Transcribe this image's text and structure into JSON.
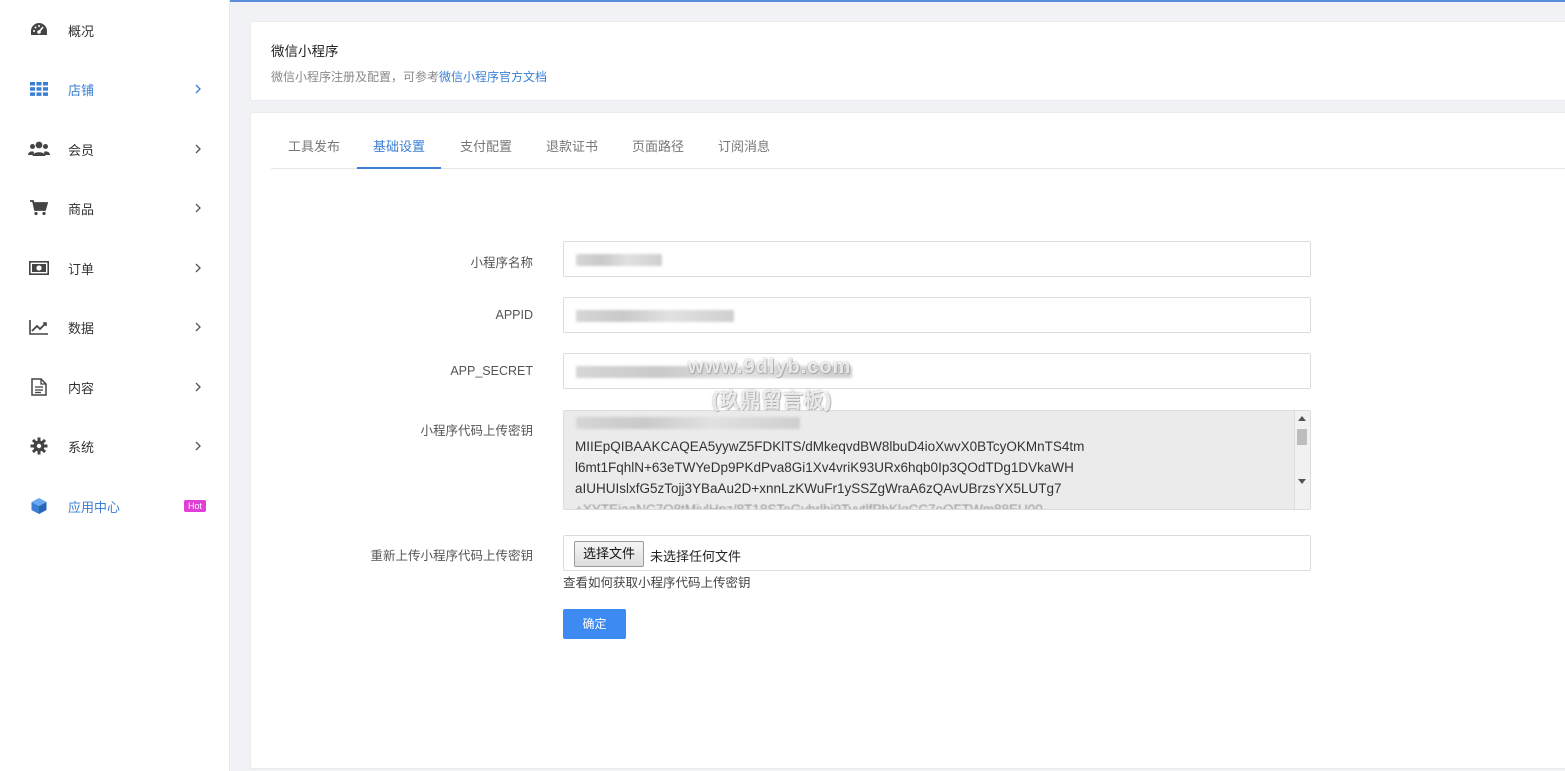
{
  "sidebar": {
    "items": [
      {
        "label": "概况",
        "icon": "dashboard-icon",
        "has_arrow": false
      },
      {
        "label": "店铺",
        "icon": "grid-icon",
        "has_arrow": true,
        "active": true
      },
      {
        "label": "会员",
        "icon": "users-icon",
        "has_arrow": true
      },
      {
        "label": "商品",
        "icon": "cart-icon",
        "has_arrow": true
      },
      {
        "label": "订单",
        "icon": "money-icon",
        "has_arrow": true
      },
      {
        "label": "数据",
        "icon": "chart-line-icon",
        "has_arrow": true
      },
      {
        "label": "内容",
        "icon": "document-icon",
        "has_arrow": true
      },
      {
        "label": "系统",
        "icon": "gear-icon",
        "has_arrow": true
      },
      {
        "label": "应用中心",
        "icon": "cube-icon",
        "has_arrow": false,
        "badge": "Hot"
      }
    ]
  },
  "header": {
    "title": "微信小程序",
    "desc_prefix": "微信小程序注册及配置，可参考",
    "desc_link": "微信小程序官方文档"
  },
  "tabs": [
    {
      "label": "工具发布"
    },
    {
      "label": "基础设置",
      "active": true
    },
    {
      "label": "支付配置"
    },
    {
      "label": "退款证书"
    },
    {
      "label": "页面路径"
    },
    {
      "label": "订阅消息"
    }
  ],
  "form": {
    "name_label": "小程序名称",
    "appid_label": "APPID",
    "secret_label": "APP_SECRET",
    "key_label": "小程序代码上传密钥",
    "key_value_lines": [
      "MIIEpQIBAAKCAQEA5yywZ5FDKlTS/dMkeqvdBW8lbuD4ioXwvX0BTcyOKMnTS4tm",
      "l6mt1FqhlN+63eTWYeDp9PKdPva8Gi1Xv4vriK93URx6hqb0Ip3QOdTDg1DVkaWH",
      "aIUHUIslxfG5zTojj3YBaAu2D+xnnLzKWuFr1ySSZgWraA6zQAvUBrzsYX5LUTg7"
    ],
    "reupload_label": "重新上传小程序代码上传密钥",
    "file_button": "选择文件",
    "file_status": "未选择任何文件",
    "help_link": "查看如何获取小程序代码上传密钥",
    "submit": "确定"
  },
  "watermark": {
    "line1": "www.9dlyb.com",
    "line2": "(玖鼎留言板)"
  },
  "colors": {
    "accent": "#3a7fd5",
    "button": "#3d8bf2",
    "hot_badge": "#e03fd8"
  }
}
